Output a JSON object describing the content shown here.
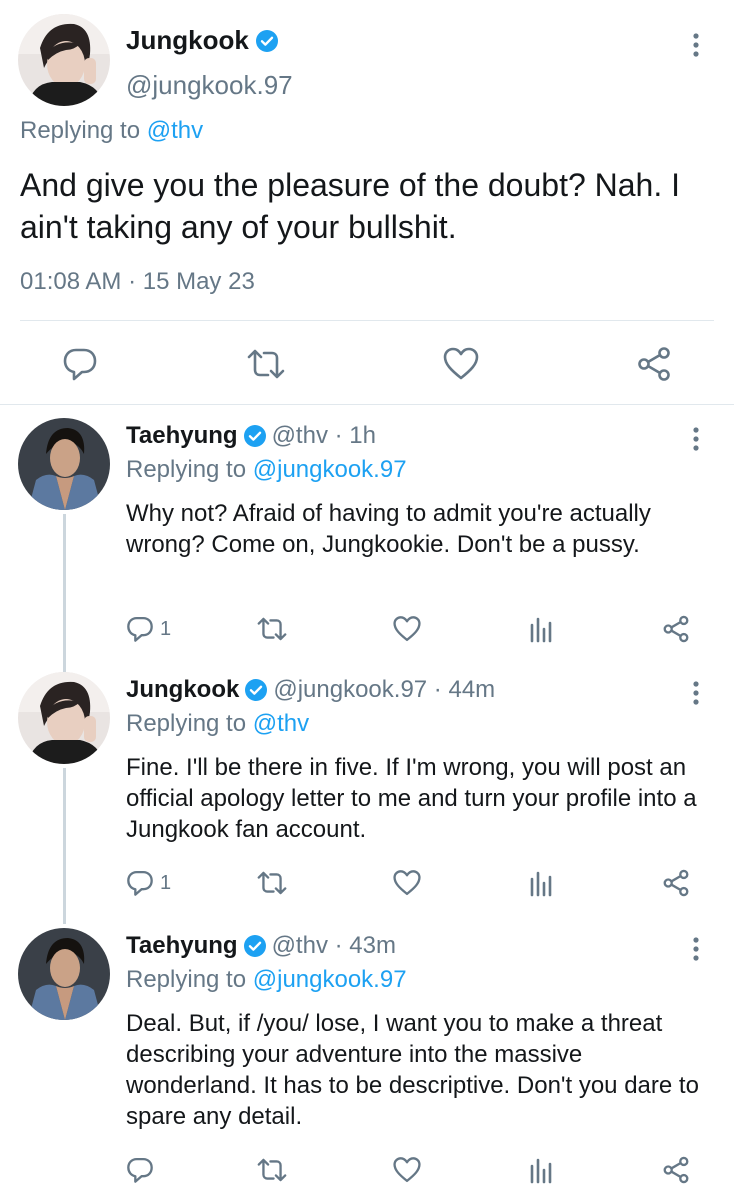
{
  "main_tweet": {
    "author": "Jungkook",
    "handle": "@jungkook.97",
    "replying_prefix": "Replying to ",
    "replying_to": "@thv",
    "text": "And give you the pleasure of the doubt? Nah. I ain't taking any of your bullshit.",
    "timestamp": "01:08 AM · 15 May 23"
  },
  "replies": [
    {
      "author": "Taehyung",
      "meta": "@thv · 1h",
      "replying_prefix": "Replying to ",
      "replying_to": "@jungkook.97",
      "text": "Why not? Afraid of having to admit you're actually wrong? Come on, Jungkookie. Don't be a pussy.",
      "reply_count": "1"
    },
    {
      "author": "Jungkook",
      "meta": "@jungkook.97 · 44m",
      "replying_prefix": "Replying to ",
      "replying_to": "@thv",
      "text": "Fine. I'll be there in five. If I'm wrong, you will post an official apology letter to me and turn your profile into a Jungkook fan account.",
      "reply_count": "1"
    },
    {
      "author": "Taehyung",
      "meta": "@thv · 43m",
      "replying_prefix": "Replying to ",
      "replying_to": "@jungkook.97",
      "text": "Deal. But, if /you/ lose, I want you to make a threat describing your adventure into the massive wonderland. It has to be descriptive. Don't you dare to spare any detail.",
      "reply_count": ""
    }
  ],
  "icons": {
    "verified": "verified-badge-icon",
    "menu": "more-vertical-icon",
    "reply": "reply-icon",
    "retweet": "retweet-icon",
    "like": "heart-icon",
    "share": "share-icon",
    "analytics": "analytics-icon"
  },
  "colors": {
    "accent": "#1da1f2",
    "text": "#14171a",
    "secondary": "#657786",
    "divider": "#e1e8ed"
  }
}
